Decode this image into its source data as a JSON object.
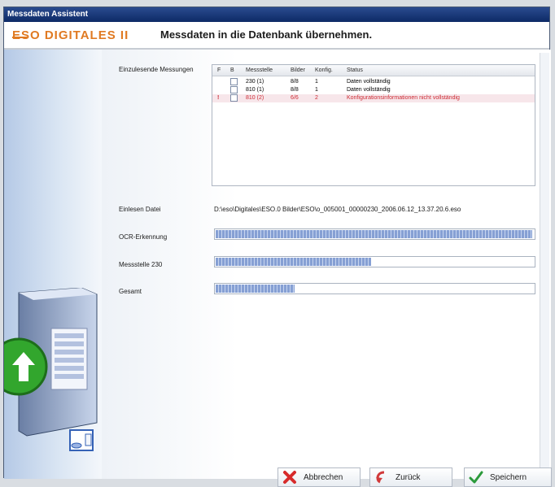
{
  "window": {
    "title": "Messdaten Assistent",
    "brand": "ESO DIGITALES II",
    "heading": "Messdaten in die Datenbank übernehmen."
  },
  "measurements": {
    "label": "Einzulesende Messungen",
    "columns": [
      "F",
      "B",
      "Messstelle",
      "Bilder",
      "Konfig.",
      "Status"
    ],
    "rows": [
      {
        "flag": "",
        "messstelle": "230 (1)",
        "bilder": "8/8",
        "konfig": "1",
        "status": "Daten vollständig",
        "error": false
      },
      {
        "flag": "",
        "messstelle": "810 (1)",
        "bilder": "8/8",
        "konfig": "1",
        "status": "Daten vollständig",
        "error": false
      },
      {
        "flag": "!",
        "messstelle": "810 (2)",
        "bilder": "6/6",
        "konfig": "2",
        "status": "Konfigurationsinformationen nicht vollständig",
        "error": true
      }
    ]
  },
  "file": {
    "label": "Einlesen Datei",
    "value": "D:\\eso\\Digitales\\ESO.0 Bilder\\ESO\\o_005001_00000230_2006.06.12_13.37.20.6.eso"
  },
  "progress": {
    "ocr": {
      "label": "OCR-Erkennung",
      "value": 1.0
    },
    "station": {
      "label": "Messstelle 230",
      "value": 0.49
    },
    "total": {
      "label": "Gesamt",
      "value": 0.25
    }
  },
  "buttons": {
    "cancel": "Abbrechen",
    "back": "Zurück",
    "save": "Speichern"
  },
  "colors": {
    "accent": "#e07a22",
    "progress": "#86a0d4",
    "error": "#cc2a33"
  },
  "icons": {
    "server": "server-icon",
    "arrow": "green-arrow-icon",
    "database": "database-icon",
    "cancel": "cancel-icon",
    "back": "back-icon",
    "save": "checkmark-icon"
  }
}
